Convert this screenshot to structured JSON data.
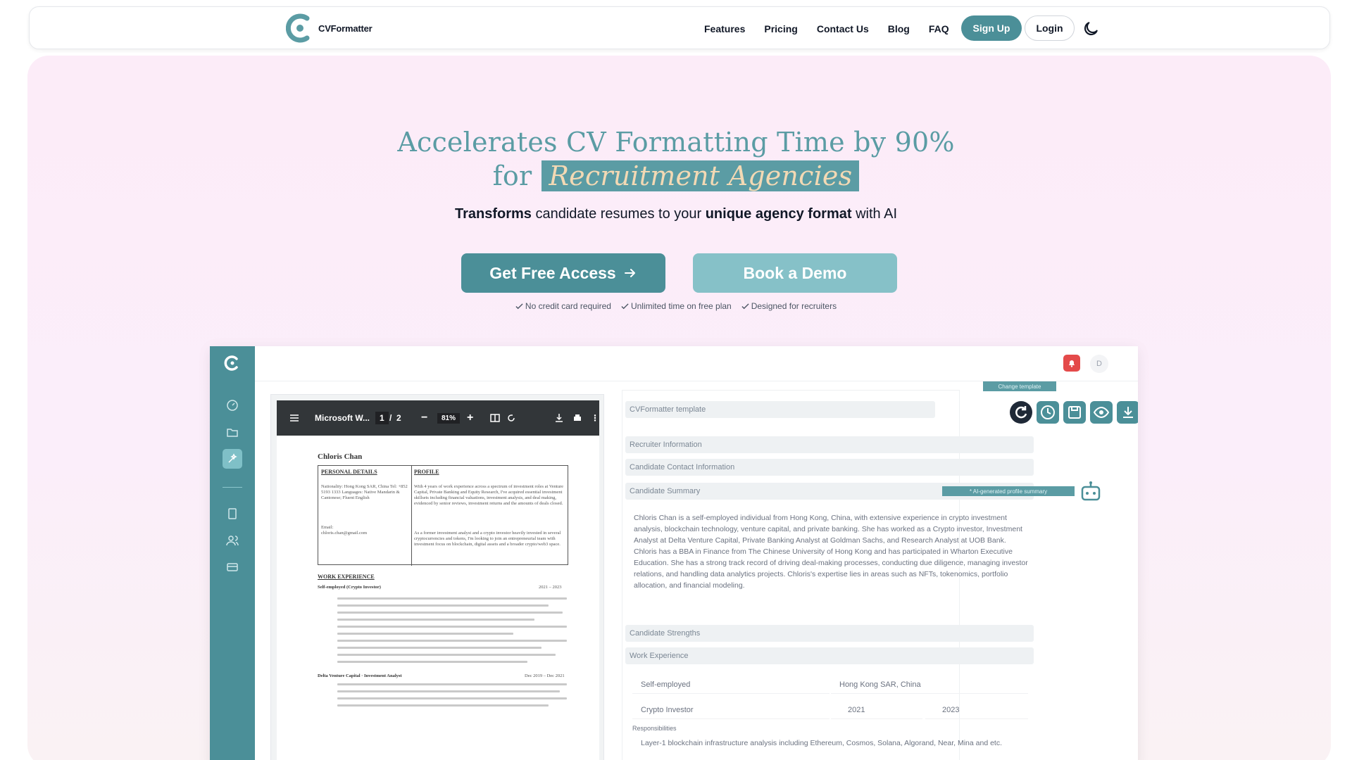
{
  "nav": {
    "logo_text": "CVFormatter",
    "links": [
      "Features",
      "Pricing",
      "Contact Us",
      "Blog",
      "FAQ"
    ],
    "signup": "Sign Up",
    "login": "Login",
    "theme_icon": "moon-icon"
  },
  "hero": {
    "title_line1": "Accelerates CV Formatting Time by 90%",
    "title_for": "for",
    "title_highlight": "Recruitment Agencies",
    "sub_bold1": "Transforms",
    "sub_text1": " candidate resumes to your ",
    "sub_bold2": "unique agency format",
    "sub_text2": " with AI",
    "cta_primary": "Get Free Access",
    "cta_secondary": "Book a Demo",
    "checks": [
      "No credit card required",
      "Unlimited time on free plan",
      "Designed for recruiters"
    ]
  },
  "app": {
    "avatar_initial": "D",
    "pdf": {
      "title": "Microsoft W...",
      "page_current": "1",
      "page_sep": "/",
      "page_total": "2",
      "zoom": "81%",
      "candidate_name": "Chloris Chan",
      "personal_details_heading": "PERSONAL DETAILS",
      "profile_heading": "PROFILE",
      "personal_details_text": "Nationality: Hong Kong SAR, China Tel: +852 5193 1333 Languages: Native Mandarin & Cantonese; Fluent English",
      "email_label": "Email:",
      "email_value": "chloris.chan@gmail.com",
      "profile_text": "With 4 years of work experience across a spectrum of investment roles at Venture Capital, Private Banking and Equity Research, I've acquired essential investment skillsets including financial valuations, investment analysis, and deal making, evidenced by senior reviews, investment returns and the amounts of deals closed.",
      "profile_text2": "As a former investment analyst and a crypto investor heavily invested in several cryptocurrencies and tokens, I'm looking to join an entrepreneurial team with investment focus on blockchain, digital assets and a broader crypto/web3 space.",
      "work_heading": "WORK EXPERIENCE",
      "job1_title": "Self-employed (Crypto Investor)",
      "job1_dates": "2021 – 2023",
      "job2_title": "Delta Venture Capital · Investment Analyst",
      "job2_dates": "Dec 2019 – Dec 2021"
    },
    "form": {
      "change_template": "Change template",
      "template_name": "CVFormatter template",
      "sections": [
        "Recruiter Information",
        "Candidate Contact Information",
        "Candidate Summary"
      ],
      "ai_chip": "* AI-generated profile summary",
      "summary": "Chloris Chan is a self-employed individual from Hong Kong, China, with extensive experience in crypto investment analysis, blockchain technology, venture capital, and private banking. She has worked as a Crypto investor, Investment Analyst at Delta Venture Capital, Private Banking Analyst at Goldman Sachs, and Research Analyst at UOB Bank. Chloris has a BBA in Finance from The Chinese University of Hong Kong and has participated in Wharton Executive Education. She has a strong track record of driving deal-making processes, conducting due diligence, managing investor relations, and handling data analytics projects. Chloris's expertise lies in areas such as NFTs, tokenomics, portfolio allocation, and financial modeling.",
      "strengths": "Candidate Strengths",
      "work_experience": "Work Experience",
      "company": "Self-employed",
      "location": "Hong Kong SAR, China",
      "role": "Crypto Investor",
      "start": "2021",
      "end": "2023",
      "responsibilities_label": "Responsibilities",
      "responsibilities": "Layer-1 blockchain infrastructure analysis including Ethereum, Cosmos, Solana, Algorand, Near, Mina and etc."
    }
  },
  "colors": {
    "accent": "#4b8f98",
    "accent_light": "#86c1c8",
    "highlight_text": "#f3d9b4"
  }
}
